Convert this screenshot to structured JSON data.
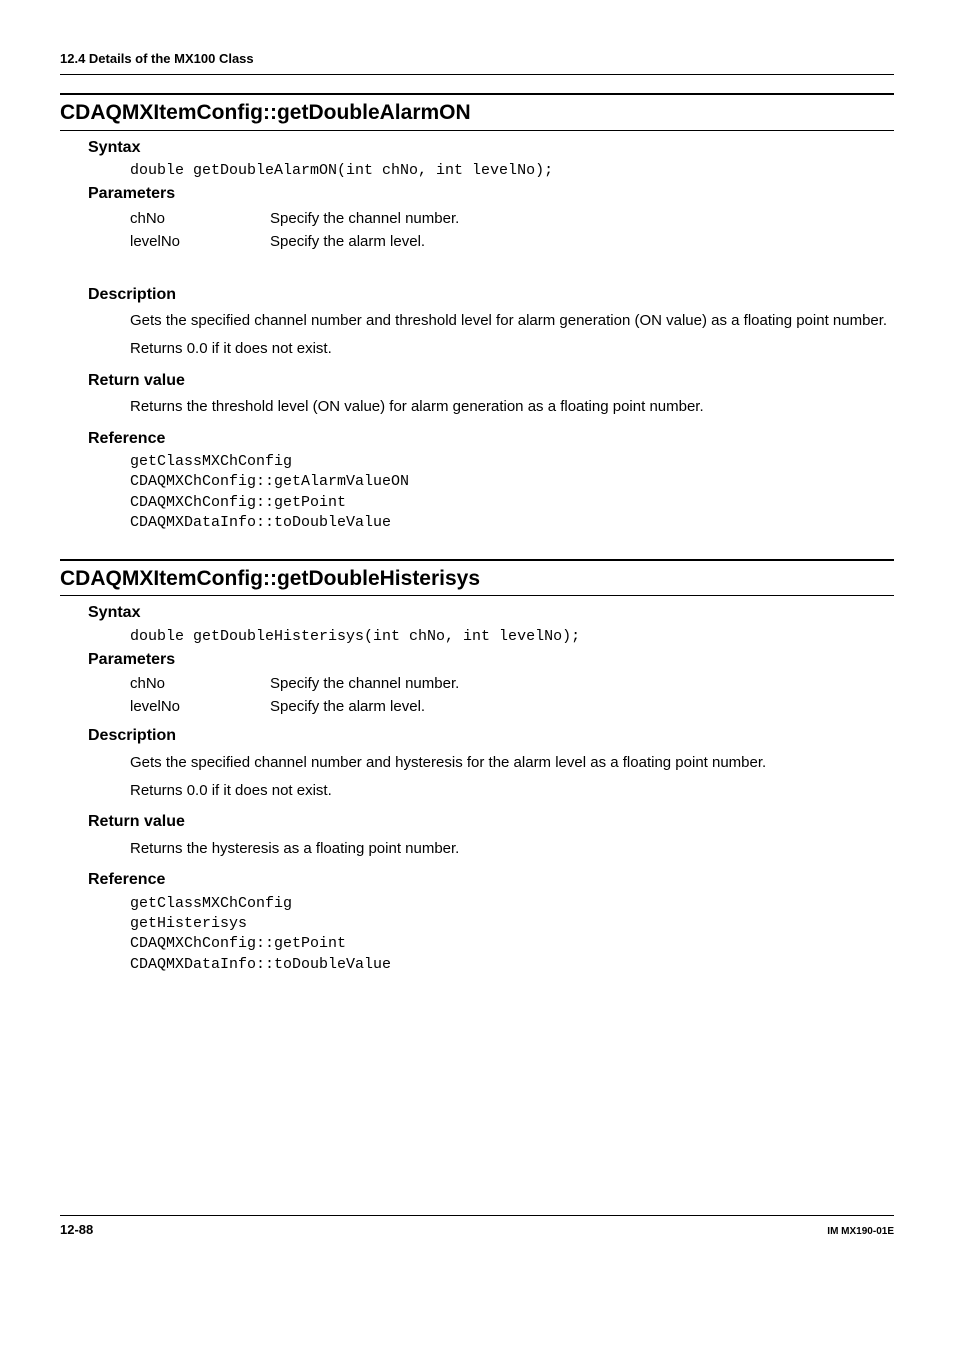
{
  "section_header": "12.4  Details of the MX100 Class",
  "method1": {
    "title": "CDAQMXItemConfig::getDoubleAlarmON",
    "syntax_label": "Syntax",
    "syntax_code": "double getDoubleAlarmON(int chNo, int levelNo);",
    "parameters_label": "Parameters",
    "params": [
      {
        "name": "chNo",
        "desc": "Specify the channel number."
      },
      {
        "name": "levelNo",
        "desc": "Specify the alarm level."
      }
    ],
    "description_label": "Description",
    "description_lines": [
      "Gets the specified channel number and threshold level for alarm generation (ON value) as a floating point number.",
      "Returns 0.0 if it does not exist."
    ],
    "return_label": "Return value",
    "return_text": "Returns the threshold level (ON value) for alarm generation as a floating point number.",
    "reference_label": "Reference",
    "reference_code": "getClassMXChConfig\nCDAQMXChConfig::getAlarmValueON\nCDAQMXChConfig::getPoint\nCDAQMXDataInfo::toDoubleValue"
  },
  "method2": {
    "title": "CDAQMXItemConfig::getDoubleHisterisys",
    "syntax_label": "Syntax",
    "syntax_code": "double getDoubleHisterisys(int chNo, int levelNo);",
    "parameters_label": "Parameters",
    "params": [
      {
        "name": "chNo",
        "desc": "Specify the channel number."
      },
      {
        "name": "levelNo",
        "desc": "Specify the alarm level."
      }
    ],
    "description_label": "Description",
    "description_lines": [
      "Gets the specified channel number and hysteresis for the alarm level as a floating point number.",
      "Returns 0.0 if it does not exist."
    ],
    "return_label": "Return value",
    "return_text": "Returns the hysteresis as a floating point number.",
    "reference_label": "Reference",
    "reference_code": "getClassMXChConfig\ngetHisterisys\nCDAQMXChConfig::getPoint\nCDAQMXDataInfo::toDoubleValue"
  },
  "footer": {
    "page": "12-88",
    "doc_id": "IM MX190-01E"
  }
}
